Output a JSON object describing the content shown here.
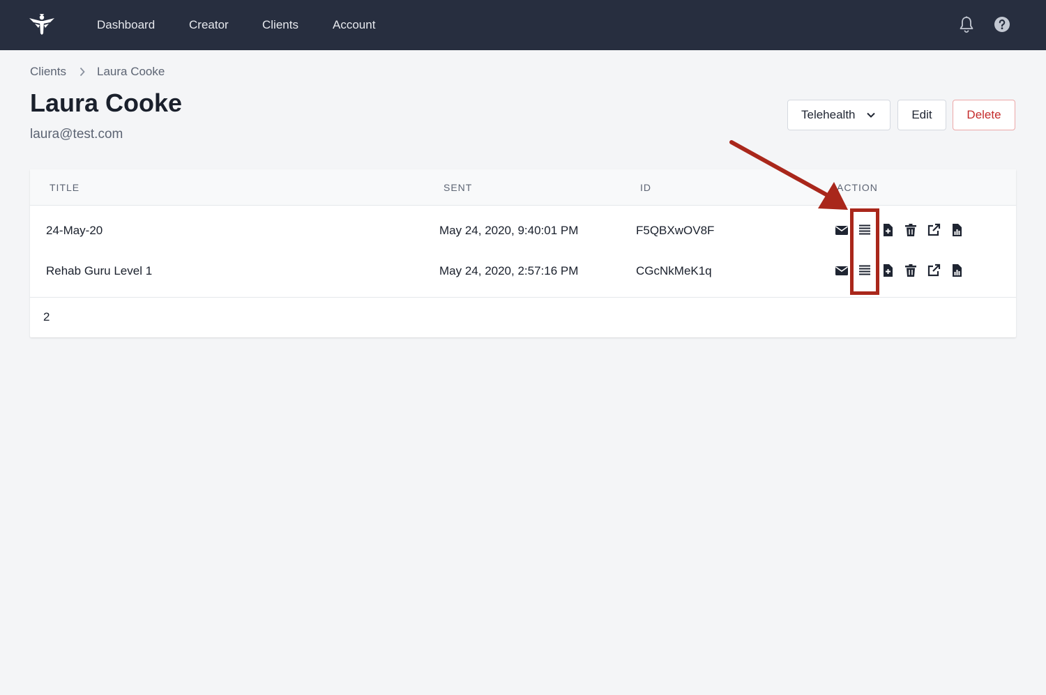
{
  "nav": {
    "items": [
      {
        "label": "Dashboard"
      },
      {
        "label": "Creator"
      },
      {
        "label": "Clients"
      },
      {
        "label": "Account"
      }
    ],
    "icons": [
      "logo-icon",
      "bell-icon",
      "help-icon"
    ]
  },
  "breadcrumb": {
    "items": [
      {
        "label": "Clients"
      },
      {
        "label": "Laura Cooke"
      }
    ]
  },
  "client": {
    "name": "Laura Cooke",
    "email": "laura@test.com"
  },
  "buttons": {
    "telehealth": "Telehealth",
    "edit": "Edit",
    "delete": "Delete"
  },
  "table": {
    "headers": {
      "title": "TITLE",
      "sent": "SENT",
      "id": "ID",
      "action": "ACTION"
    },
    "rows": [
      {
        "title": "24-May-20",
        "sent": "May 24, 2020, 9:40:01 PM",
        "id": "F5QBXwOV8F"
      },
      {
        "title": "Rehab Guru Level 1",
        "sent": "May 24, 2020, 2:57:16 PM",
        "id": "CGcNkMeK1q"
      }
    ],
    "action_icons": [
      "email-icon",
      "list-icon",
      "add-file-icon",
      "trash-icon",
      "external-link-icon",
      "report-icon"
    ],
    "count": "2"
  },
  "colors": {
    "topbar": "#272e3f",
    "background": "#f4f5f7",
    "delete": "#c42b2b",
    "annotation": "#a9271b"
  }
}
